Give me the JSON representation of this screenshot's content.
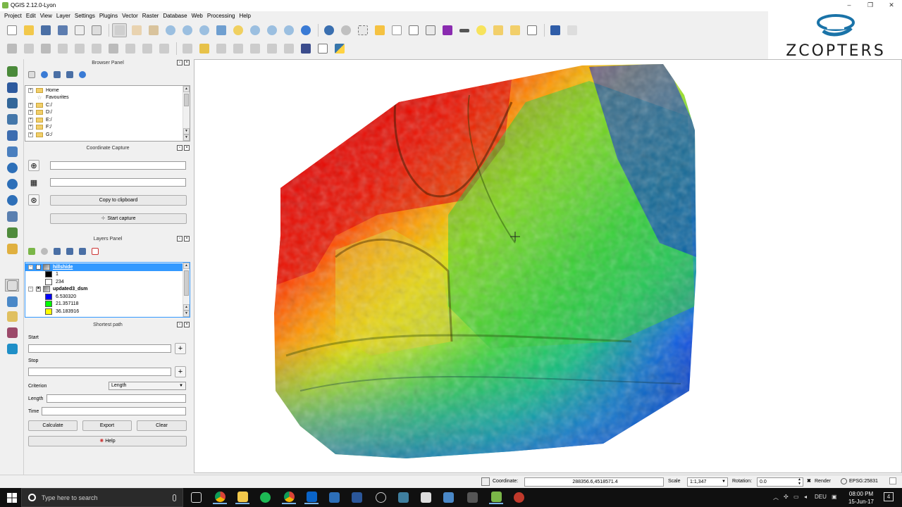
{
  "window": {
    "title": "QGIS 2.12.0-Lyon",
    "minimize": "–",
    "maximize": "❐",
    "close": "✕"
  },
  "menu": [
    "Project",
    "Edit",
    "View",
    "Layer",
    "Settings",
    "Plugins",
    "Vector",
    "Raster",
    "Database",
    "Web",
    "Processing",
    "Help"
  ],
  "logo": {
    "text": "ZCOPTERS",
    "accent": "#1a73a8"
  },
  "browser_panel": {
    "title": "Browser Panel",
    "items": [
      {
        "label": "Home",
        "kind": "folder",
        "expandable": true
      },
      {
        "label": "Favourites",
        "kind": "star",
        "expandable": false
      },
      {
        "label": "C:/",
        "kind": "folder",
        "expandable": true
      },
      {
        "label": "D:/",
        "kind": "folder",
        "expandable": true
      },
      {
        "label": "E:/",
        "kind": "folder",
        "expandable": true
      },
      {
        "label": "F:/",
        "kind": "folder",
        "expandable": true
      },
      {
        "label": "G:/",
        "kind": "folder",
        "expandable": true
      }
    ]
  },
  "coordinate_capture": {
    "title": "Coordinate Capture",
    "field1": "",
    "field2": "",
    "copy_button": "Copy to clipboard",
    "start_button": "Start capture"
  },
  "layers_panel": {
    "title": "Layers Panel",
    "layers": [
      {
        "name": "hillshide",
        "checked": true,
        "selected": true,
        "legend": [
          {
            "label": "1",
            "color": "#000000"
          },
          {
            "label": "234",
            "color": "#ffffff"
          }
        ]
      },
      {
        "name": "updated3_dsm",
        "checked": true,
        "selected": false,
        "legend": [
          {
            "label": "6.530320",
            "color": "#0000ff"
          },
          {
            "label": "21.357118",
            "color": "#00ff00"
          },
          {
            "label": "36.183916",
            "color": "#ffff00"
          }
        ]
      }
    ]
  },
  "shortest_path": {
    "title": "Shortest path",
    "start_label": "Start",
    "start_value": "",
    "stop_label": "Stop",
    "stop_value": "",
    "criterion_label": "Criterion",
    "criterion_value": "Length",
    "length_label": "Length",
    "length_value": "",
    "time_label": "Time",
    "time_value": "",
    "calculate": "Calculate",
    "export": "Export",
    "clear": "Clear",
    "help": "Help"
  },
  "statusbar": {
    "coordinate_label": "Coordinate:",
    "coordinate_value": "288356.6,4518571.4",
    "scale_label": "Scale",
    "scale_value": "1:1,347",
    "rotation_label": "Rotation:",
    "rotation_value": "0.0",
    "render_label": "Render",
    "crs": "EPSG:25831"
  },
  "taskbar": {
    "search_placeholder": "Type here to search",
    "time": "08:00 PM",
    "date": "15-Jun-17",
    "language": "DEU",
    "notification_count": "4"
  },
  "colors": {
    "selection": "#3399ff",
    "dsm_low": "#0000ff",
    "dsm_mid": "#00ff00",
    "dsm_high": "#ff0000"
  }
}
